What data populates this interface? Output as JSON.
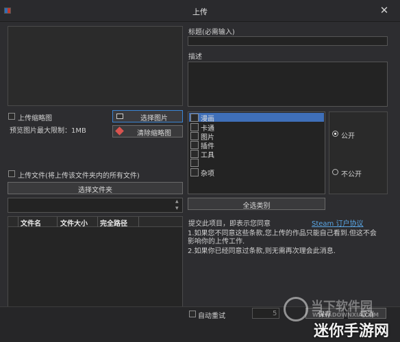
{
  "window": {
    "title": "上传"
  },
  "preview": {
    "upload_thumbnail_label": "上传缩略图",
    "size_limit": "预览图片最大限制：1MB",
    "select_image_button": "选择图片",
    "clear_thumbnail_button": "清除缩略图"
  },
  "files": {
    "upload_files_label": "上传文件(将上传该文件夹内的所有文件)",
    "select_folder_button": "选择文件夹",
    "columns": [
      "文件名",
      "文件大小",
      "完全路径"
    ]
  },
  "form": {
    "title_label": "标题(必需输入)",
    "title_value": "",
    "description_label": "描述",
    "description_value": ""
  },
  "categories": {
    "items": [
      {
        "label": "漫画",
        "checked": false,
        "selected": true
      },
      {
        "label": "卡通",
        "checked": false,
        "selected": false
      },
      {
        "label": "图片",
        "checked": false,
        "selected": false
      },
      {
        "label": "插件",
        "checked": false,
        "selected": false
      },
      {
        "label": "工具",
        "checked": false,
        "selected": false
      },
      {
        "label": "",
        "checked": false,
        "selected": false
      },
      {
        "label": "杂项",
        "checked": false,
        "selected": false
      }
    ],
    "select_all_button": "全选类别"
  },
  "visibility": {
    "public_label": "公开",
    "private_label": "不公开",
    "selected": "public"
  },
  "agreement": {
    "intro": "提交此项目，即表示您同意",
    "link": "Steam 订户协议",
    "line1a": "1.如果您不同意这些条款,您上传的作品只能自己看到.但这不会",
    "line1b": "影响你的上传工作.",
    "line2": "2.如果你已经同意过条款,则无需再次理会此消息."
  },
  "bottom": {
    "auto_retry_label": "自动重试",
    "retry_value": "5",
    "save_button": "保存",
    "cancel_button": "取消"
  },
  "watermark": {
    "brand_top": "当下软件园",
    "brand_url": "WWW.DOWNXIA.COM",
    "brand_main": "迷你手游网"
  }
}
